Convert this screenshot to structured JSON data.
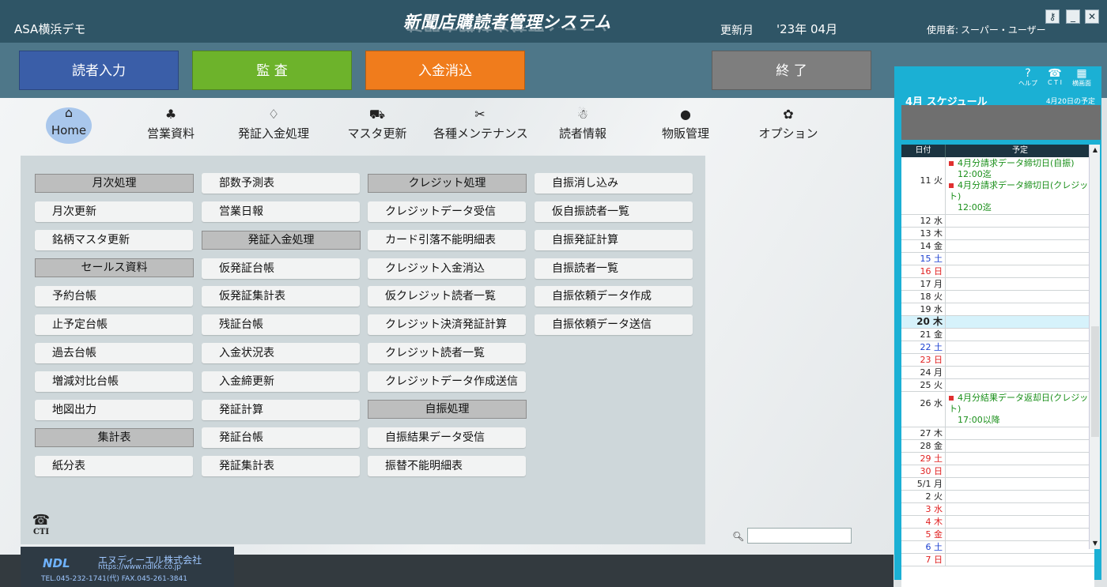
{
  "header": {
    "company": "ASA横浜デモ",
    "title": "新聞店購読者管理システム",
    "month_label": "更新月",
    "month_value": "'23年 04月",
    "user_label": "使用者:",
    "user_name": "スーパー・ユーザー"
  },
  "window_controls": {
    "key_glyph": "⚷",
    "minimize_glyph": "_",
    "close_glyph": "✕"
  },
  "toolbar": [
    {
      "label": "読者入力",
      "color": "#3a5ea8"
    },
    {
      "label": "監 査",
      "color": "#6db32b"
    },
    {
      "label": "入金消込",
      "color": "#f07c1c"
    },
    {
      "label": "終 了",
      "color": "#7e7e7e"
    }
  ],
  "nav": [
    {
      "label": "Home",
      "icon": "home-icon",
      "glyph": "⌂"
    },
    {
      "label": "営業資料",
      "icon": "clover-icon",
      "glyph": "♣"
    },
    {
      "label": "発証入金処理",
      "icon": "diamond-icon",
      "glyph": "♢"
    },
    {
      "label": "マスタ更新",
      "icon": "scooter-icon",
      "glyph": "⛟"
    },
    {
      "label": "各種メンテナンス",
      "icon": "tools-icon",
      "glyph": "✂"
    },
    {
      "label": "読者情報",
      "icon": "gingerbread-icon",
      "glyph": "☃"
    },
    {
      "label": "物販管理",
      "icon": "pumpkin-icon",
      "glyph": "●"
    },
    {
      "label": "オプション",
      "icon": "flower-icon",
      "glyph": "✿"
    }
  ],
  "menu": {
    "col1": [
      {
        "type": "header",
        "label": "月次処理"
      },
      {
        "type": "item",
        "label": "月次更新"
      },
      {
        "type": "item",
        "label": "銘柄マスタ更新"
      },
      {
        "type": "header",
        "label": "セールス資料"
      },
      {
        "type": "item",
        "label": "予約台帳"
      },
      {
        "type": "item",
        "label": "止予定台帳"
      },
      {
        "type": "item",
        "label": "過去台帳"
      },
      {
        "type": "item",
        "label": "増減対比台帳"
      },
      {
        "type": "item",
        "label": "地図出力"
      },
      {
        "type": "header",
        "label": "集計表"
      },
      {
        "type": "item",
        "label": "紙分表"
      }
    ],
    "col2": [
      {
        "type": "item",
        "label": "部数予測表"
      },
      {
        "type": "item",
        "label": "営業日報"
      },
      {
        "type": "header",
        "label": "発証入金処理"
      },
      {
        "type": "item",
        "label": "仮発証台帳"
      },
      {
        "type": "item",
        "label": "仮発証集計表"
      },
      {
        "type": "item",
        "label": "残証台帳"
      },
      {
        "type": "item",
        "label": "入金状況表"
      },
      {
        "type": "item",
        "label": "入金締更新"
      },
      {
        "type": "item",
        "label": "発証計算"
      },
      {
        "type": "item",
        "label": "発証台帳"
      },
      {
        "type": "item",
        "label": "発証集計表"
      }
    ],
    "col3": [
      {
        "type": "header",
        "label": "クレジット処理"
      },
      {
        "type": "item",
        "label": "クレジットデータ受信"
      },
      {
        "type": "item",
        "label": "カード引落不能明細表"
      },
      {
        "type": "item",
        "label": "クレジット入金消込"
      },
      {
        "type": "item",
        "label": "仮クレジット読者一覧"
      },
      {
        "type": "item",
        "label": "クレジット決済発証計算"
      },
      {
        "type": "item",
        "label": "クレジット読者一覧"
      },
      {
        "type": "item",
        "label": "クレジットデータ作成送信"
      },
      {
        "type": "header",
        "label": "自振処理"
      },
      {
        "type": "item",
        "label": "自振結果データ受信"
      },
      {
        "type": "item",
        "label": "振替不能明細表"
      }
    ],
    "col4": [
      {
        "type": "item",
        "label": "自振消し込み"
      },
      {
        "type": "item",
        "label": "仮自振読者一覧"
      },
      {
        "type": "item",
        "label": "自振発証計算"
      },
      {
        "type": "item",
        "label": "自振読者一覧"
      },
      {
        "type": "item",
        "label": "自振依頼データ作成"
      },
      {
        "type": "item",
        "label": "自振依頼データ送信"
      }
    ]
  },
  "cti": {
    "label": "CTI",
    "glyph": "☎"
  },
  "search": {
    "placeholder": "",
    "icon": "search-icon",
    "glyph": "🔍︎"
  },
  "footer": {
    "logo": "NDL",
    "company": "エヌディーエル株式会社",
    "url": "https://www.ndlkk.co.jp",
    "tel": "TEL.045-232-1741(代) FAX.045-261-3841"
  },
  "schedule": {
    "icons": [
      {
        "label": "ヘルプ",
        "glyph": "?"
      },
      {
        "label": "C T I",
        "glyph": "☎"
      },
      {
        "label": "横画面",
        "glyph": "▦"
      }
    ],
    "title": "4月 スケジュール",
    "today_note": "4月20日の予定",
    "col_date": "日付",
    "col_plan": "予定",
    "colors": {
      "saturday": "#1a3fd0",
      "sunday": "#e02020",
      "weekday": "#222222",
      "event": "#1a8f1a",
      "today_bg": "#d6f2fb"
    },
    "rows": [
      {
        "date": "11 火",
        "kind": "weekday",
        "events": [
          {
            "title": "4月分請求データ締切日(自振)",
            "time": "12:00迄"
          },
          {
            "title": "4月分請求データ締切日(クレジット)",
            "time": "12:00迄"
          }
        ]
      },
      {
        "date": "12 水",
        "kind": "weekday",
        "events": []
      },
      {
        "date": "13 木",
        "kind": "weekday",
        "events": []
      },
      {
        "date": "14 金",
        "kind": "weekday",
        "events": []
      },
      {
        "date": "15 土",
        "kind": "saturday",
        "events": []
      },
      {
        "date": "16 日",
        "kind": "sunday",
        "events": []
      },
      {
        "date": "17 月",
        "kind": "weekday",
        "events": []
      },
      {
        "date": "18 火",
        "kind": "weekday",
        "events": []
      },
      {
        "date": "19 水",
        "kind": "weekday",
        "events": []
      },
      {
        "date": "20 木",
        "kind": "today",
        "events": []
      },
      {
        "date": "21 金",
        "kind": "weekday",
        "events": []
      },
      {
        "date": "22 土",
        "kind": "saturday",
        "events": []
      },
      {
        "date": "23 日",
        "kind": "sunday",
        "events": []
      },
      {
        "date": "24 月",
        "kind": "weekday",
        "events": []
      },
      {
        "date": "25 火",
        "kind": "weekday",
        "events": []
      },
      {
        "date": "26 水",
        "kind": "weekday",
        "events": [
          {
            "title": "4月分結果データ返却日(クレジット)",
            "time": "17:00以降"
          }
        ]
      },
      {
        "date": "27 木",
        "kind": "weekday",
        "events": []
      },
      {
        "date": "28 金",
        "kind": "weekday",
        "events": []
      },
      {
        "date": "29 土",
        "kind": "sunday",
        "events": []
      },
      {
        "date": "30 日",
        "kind": "sunday",
        "events": []
      },
      {
        "date": "5/1 月",
        "kind": "weekday",
        "events": []
      },
      {
        "date": "2 火",
        "kind": "weekday",
        "events": []
      },
      {
        "date": "3 水",
        "kind": "sunday",
        "events": []
      },
      {
        "date": "4 木",
        "kind": "sunday",
        "events": []
      },
      {
        "date": "5 金",
        "kind": "sunday",
        "events": []
      },
      {
        "date": "6 土",
        "kind": "saturday",
        "events": []
      },
      {
        "date": "7 日",
        "kind": "sunday",
        "events": []
      }
    ]
  }
}
